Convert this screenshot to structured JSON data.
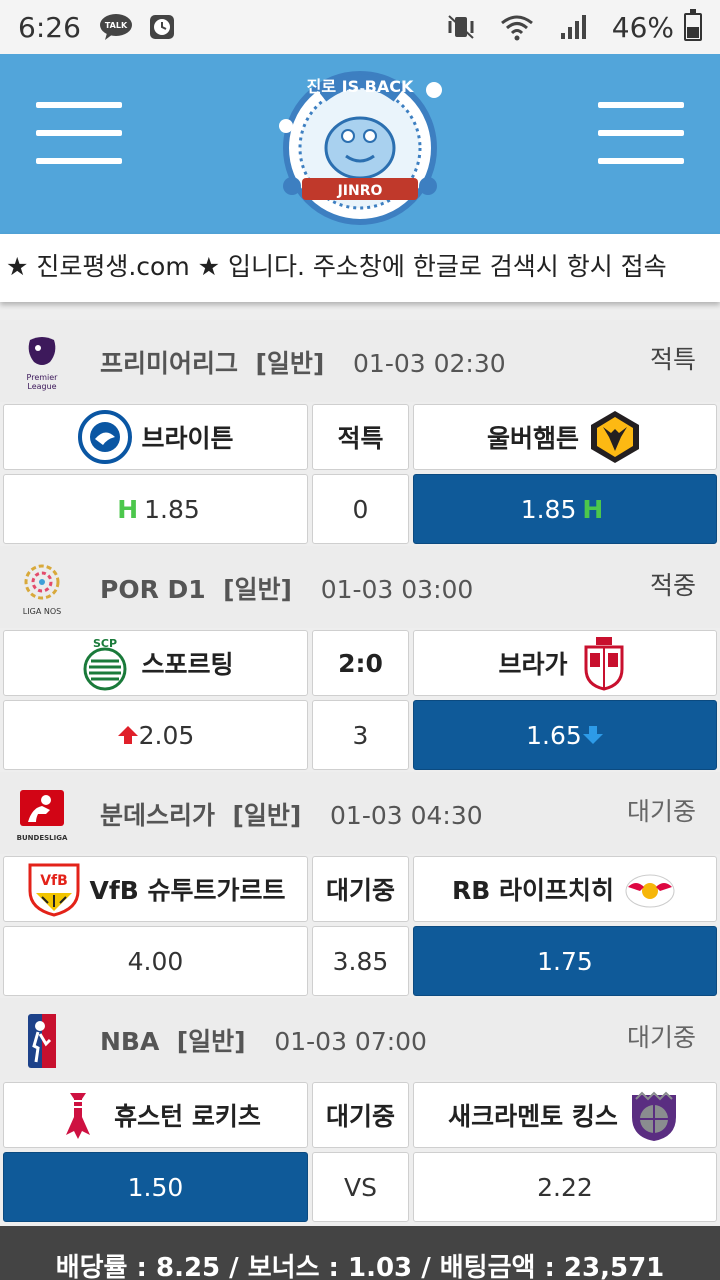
{
  "status_bar": {
    "time": "6:26",
    "battery": "46%",
    "icons": [
      "talk-icon",
      "clock-icon",
      "vibrate-icon",
      "wifi-icon",
      "signal-icon",
      "battery-icon"
    ]
  },
  "header": {
    "logo_text_top": "진로 IS BACK",
    "logo_text_bottom": "JINRO"
  },
  "notice": {
    "text": "★ 진로평생.com ★ 입니다. 주소창에 한글로 검색시 항시 접속"
  },
  "matches": [
    {
      "league": "프리미어리그",
      "type": "[일반]",
      "datetime": "01-03 02:30",
      "status": "적특",
      "home": "브라이튼",
      "away": "울버햄튼",
      "center": "적특",
      "odd_home": "1.85",
      "odd_draw": "0",
      "odd_away": "1.85",
      "home_mark": "H",
      "away_mark": "H"
    },
    {
      "league": "POR D1",
      "type": "[일반]",
      "datetime": "01-03 03:00",
      "status": "적중",
      "home": "스포르팅",
      "away": "브라가",
      "center": "2:0",
      "odd_home": "2.05",
      "odd_draw": "3",
      "odd_away": "1.65",
      "home_mark": "▲",
      "away_mark": "▼"
    },
    {
      "league": "분데스리가",
      "type": "[일반]",
      "datetime": "01-03 04:30",
      "status": "대기중",
      "home": "VfB 슈투트가르트",
      "away": "RB 라이프치히",
      "center": "대기중",
      "odd_home": "4.00",
      "odd_draw": "3.85",
      "odd_away": "1.75"
    },
    {
      "league": "NBA",
      "type": "[일반]",
      "datetime": "01-03 07:00",
      "status": "대기중",
      "home": "휴스턴 로키츠",
      "away": "새크라멘토 킹스",
      "center": "대기중",
      "odd_home": "1.50",
      "odd_draw": "VS",
      "odd_away": "2.22"
    }
  ],
  "footer": {
    "text": "배당률 : 8.25 / 보너스 : 1.03 / 배팅금액 : 23,571"
  },
  "colors": {
    "header_bg": "#52a5da",
    "selected_bg": "#0f5a99",
    "footer_bg": "#444444",
    "h_mark": "#4cc74c",
    "up_arrow": "#e0202a",
    "down_arrow": "#2d9be8"
  }
}
